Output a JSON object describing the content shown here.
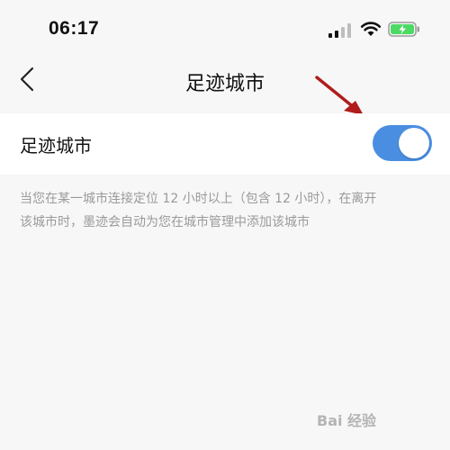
{
  "status_bar": {
    "time": "06:17",
    "signal_icon": "cellular-signal-icon",
    "wifi_icon": "wifi-icon",
    "battery_icon": "battery-charging-icon",
    "battery_color": "#4cd964"
  },
  "nav": {
    "title": "足迹城市",
    "back_icon": "chevron-left-icon"
  },
  "settings": {
    "footprint_city": {
      "label": "足迹城市",
      "enabled": true,
      "toggle_color": "#4a8ee2"
    }
  },
  "description": {
    "line1": "当您在某一城市连接定位 12 小时以上（包含 12 小时），在离开",
    "line2": "该城市时，墨迹会自动为您在城市管理中添加该城市"
  },
  "annotation": {
    "arrow_icon": "red-arrow-icon",
    "color": "#b01c1c"
  },
  "watermark": {
    "text": "Bai 经验"
  }
}
